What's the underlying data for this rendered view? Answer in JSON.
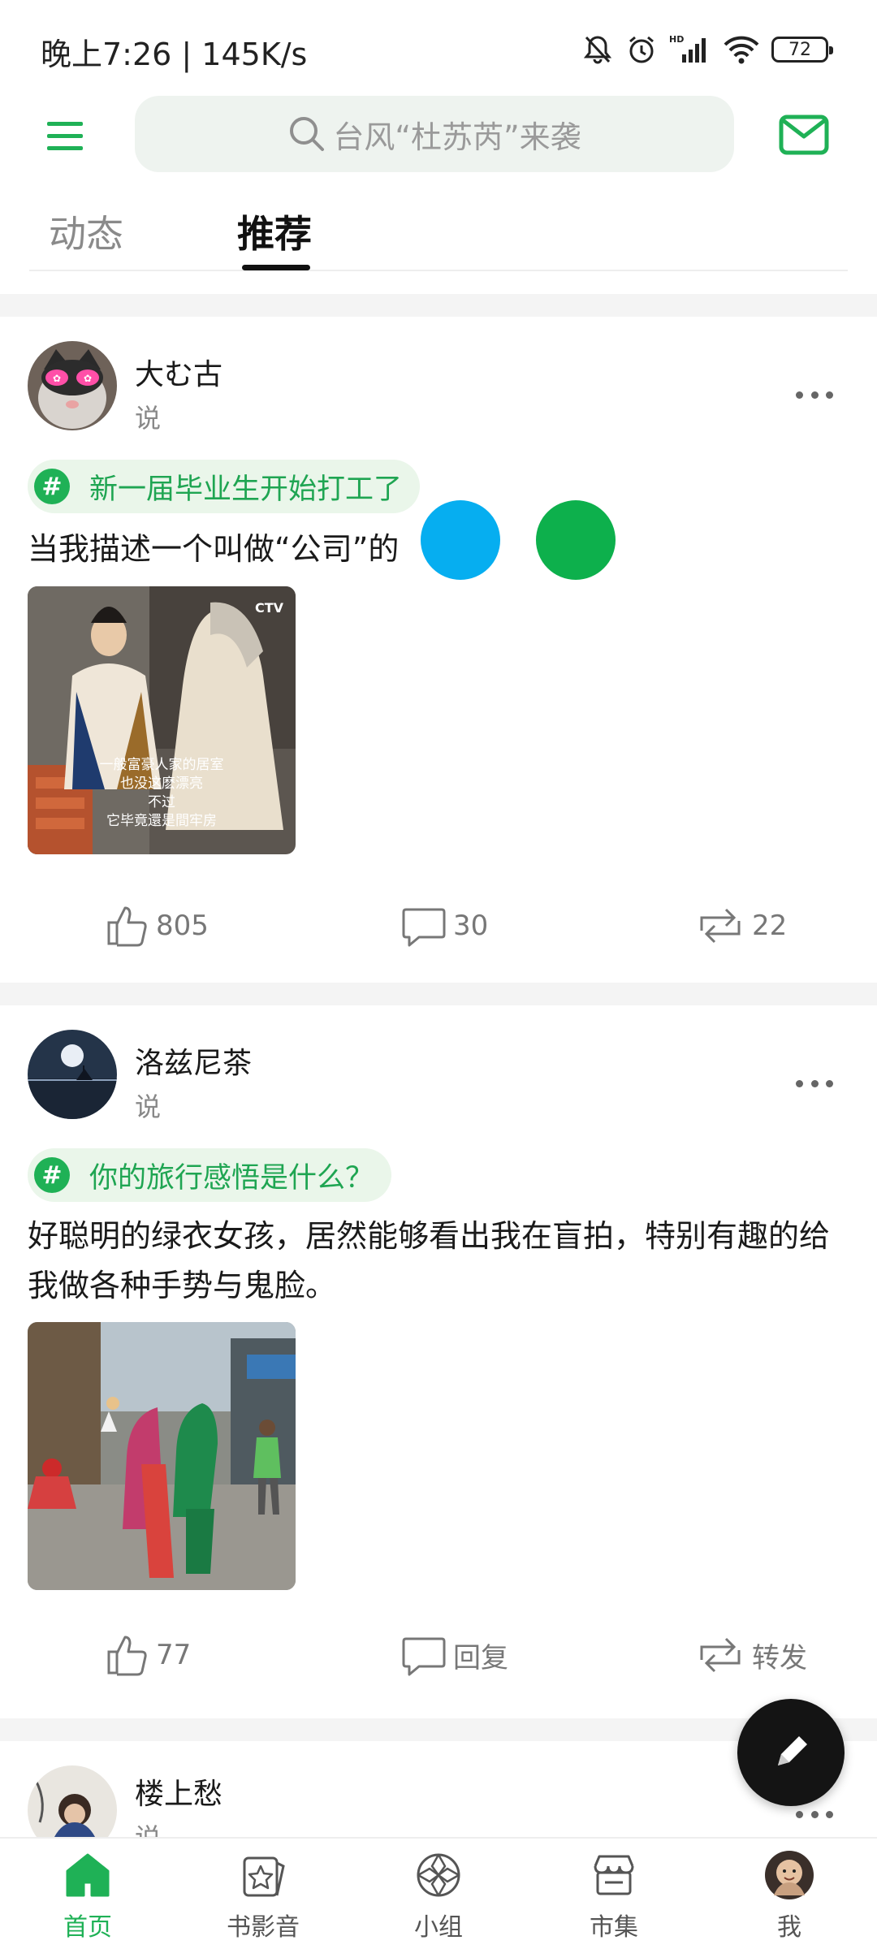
{
  "status_bar": {
    "time": "晚上7:26 | 145K/s",
    "battery": "72",
    "icons": [
      "bell-off-icon",
      "alarm-icon",
      "hd-signal-icon",
      "wifi-icon",
      "battery-icon"
    ]
  },
  "header": {
    "menu_icon": "hamburger-menu-icon",
    "search_placeholder": "台风“杜苏芮”来袭",
    "mail_icon": "mail-icon"
  },
  "tabs": [
    {
      "label": "动态",
      "active": false
    },
    {
      "label": "推荐",
      "active": true
    }
  ],
  "posts": [
    {
      "username": "大む古",
      "subtitle": "说",
      "topic": "新一届毕业生开始打工了",
      "text": "当我描述一个叫做“公司”的",
      "text_end": "：",
      "image_caption": [
        "一般富豪人家的居室",
        "也没这麽漂亮",
        "不过",
        "它毕竟還是間牢房"
      ],
      "image_logo": "CTV",
      "likes": "805",
      "comments": "30",
      "reposts": "22"
    },
    {
      "username": "洛兹尼茶",
      "subtitle": "说",
      "topic": "你的旅行感悟是什么？",
      "text": "好聪明的绿衣女孩，居然能够看出我在盲拍，特别有趣的给我做各种手势与鬼脸。",
      "likes": "77",
      "comments": "回复",
      "reposts": "转发"
    },
    {
      "username": "楼上愁",
      "subtitle": "说"
    }
  ],
  "overlay_dots": {
    "blue": "#06aef0",
    "green": "#0db04c"
  },
  "fab_icon": "pencil-icon",
  "bottom_nav": [
    {
      "label": "首页",
      "icon": "home-icon",
      "active": true
    },
    {
      "label": "书影音",
      "icon": "book-film-music-icon",
      "active": false
    },
    {
      "label": "小组",
      "icon": "groups-icon",
      "active": false
    },
    {
      "label": "市集",
      "icon": "market-icon",
      "active": false
    },
    {
      "label": "我",
      "icon": "profile-avatar",
      "active": false
    }
  ],
  "colors": {
    "accent": "#1fb156",
    "topic_bg": "#eaf6ea",
    "search_bg": "#eef3ef"
  }
}
